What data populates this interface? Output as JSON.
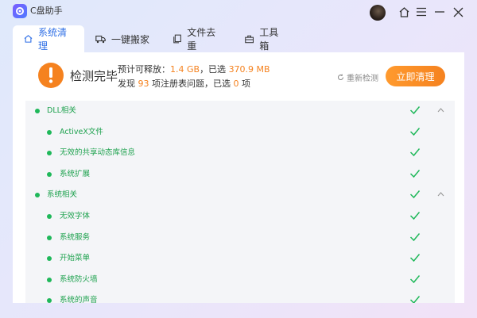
{
  "app": {
    "title": "C盘助手"
  },
  "tabs": [
    {
      "label": "系统清理",
      "icon": "home-icon",
      "active": true
    },
    {
      "label": "一键搬家",
      "icon": "truck-icon",
      "active": false
    },
    {
      "label": "文件去重",
      "icon": "file-copy-icon",
      "active": false
    },
    {
      "label": "工具箱",
      "icon": "toolbox-icon",
      "active": false
    }
  ],
  "status": {
    "title": "检测完毕",
    "line1": {
      "prefix": "预计可释放：",
      "release_size": "1.4 GB",
      "middle": "，已选",
      "selected_size": "370.9 MB"
    },
    "line2": {
      "prefix": "发现",
      "issue_count": "93",
      "middle": "项注册表问题，已选",
      "selected_count": "0",
      "suffix": "项"
    },
    "rescan_label": "重新检测",
    "clean_button": "立即清理"
  },
  "colors": {
    "accent_blue": "#2f6fe6",
    "accent_orange": "#f5821f",
    "success_green": "#1fb85a"
  },
  "scan_list": [
    {
      "label": "DLL相关",
      "level": 0,
      "checked": true,
      "expanded": true
    },
    {
      "label": "ActiveX文件",
      "level": 1,
      "checked": true
    },
    {
      "label": "无效的共享动态库信息",
      "level": 1,
      "checked": true
    },
    {
      "label": "系统扩展",
      "level": 1,
      "checked": true
    },
    {
      "label": "系统相关",
      "level": 0,
      "checked": true,
      "expanded": true
    },
    {
      "label": "无效字体",
      "level": 1,
      "checked": true
    },
    {
      "label": "系统服务",
      "level": 1,
      "checked": true
    },
    {
      "label": "开始菜单",
      "level": 1,
      "checked": true
    },
    {
      "label": "系统防火墙",
      "level": 1,
      "checked": true
    },
    {
      "label": "系统的声音",
      "level": 1,
      "checked": true
    }
  ]
}
